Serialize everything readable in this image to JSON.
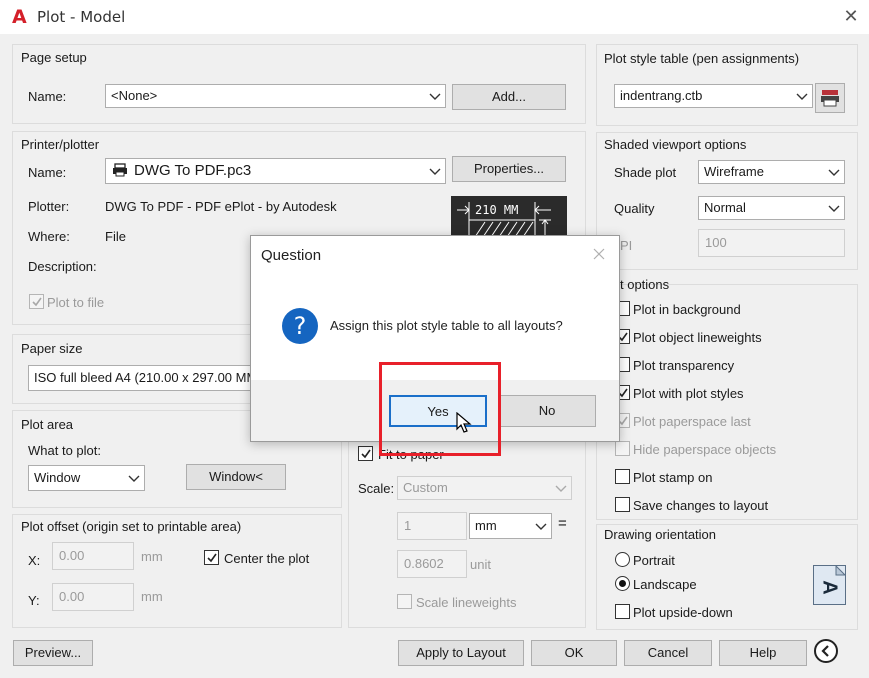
{
  "window": {
    "title": "Plot - Model",
    "close_glyph": "✕",
    "logo_letter": "A"
  },
  "page_setup": {
    "group": "Page setup",
    "name_label": "Name:",
    "name_value": "<None>",
    "add_button": "Add..."
  },
  "printer": {
    "group": "Printer/plotter",
    "name_label": "Name:",
    "name_value": "DWG To PDF.pc3",
    "properties_button": "Properties...",
    "plotter_label": "Plotter:",
    "plotter_value": "DWG To PDF - PDF ePlot - by Autodesk",
    "where_label": "Where:",
    "where_value": "File",
    "description_label": "Description:",
    "plot_to_file": "Plot to file",
    "preview_dim": "210 MM"
  },
  "paper_size": {
    "group": "Paper size",
    "value": "ISO full bleed A4 (210.00 x 297.00 MM"
  },
  "plot_area": {
    "group": "Plot area",
    "what_label": "What to plot:",
    "what_value": "Window",
    "window_button": "Window<"
  },
  "plot_offset": {
    "group": "Plot offset (origin set to printable area)",
    "x_label": "X:",
    "x_value": "0.00",
    "x_unit": "mm",
    "y_label": "Y:",
    "y_value": "0.00",
    "y_unit": "mm",
    "center_label": "Center the plot"
  },
  "plot_scale": {
    "fit_label": "Fit to paper",
    "scale_label": "Scale:",
    "scale_value": "Custom",
    "num_value": "1",
    "unit_value": "mm",
    "equals": "=",
    "den_value": "0.8602",
    "den_unit": "unit",
    "lineweights_label": "Scale lineweights"
  },
  "plot_style_table": {
    "group": "Plot style table (pen assignments)",
    "value": "indentrang.ctb"
  },
  "shaded_viewport": {
    "group": "Shaded viewport options",
    "shade_label": "Shade plot",
    "shade_value": "Wireframe",
    "quality_label": "Quality",
    "quality_value": "Normal",
    "dpi_label": "PI",
    "dpi_value": "100"
  },
  "plot_options": {
    "group": "t options",
    "items": [
      {
        "label": "Plot in background",
        "checked": false,
        "disabled": false
      },
      {
        "label": "Plot object lineweights",
        "checked": true,
        "disabled": false
      },
      {
        "label": "Plot transparency",
        "checked": false,
        "disabled": false
      },
      {
        "label": "Plot with plot styles",
        "checked": true,
        "disabled": false
      },
      {
        "label": "Plot paperspace last",
        "checked": true,
        "disabled": true
      },
      {
        "label": "Hide paperspace objects",
        "checked": false,
        "disabled": true
      },
      {
        "label": "Plot stamp on",
        "checked": false,
        "disabled": false
      },
      {
        "label": "Save changes to layout",
        "checked": false,
        "disabled": false
      }
    ]
  },
  "drawing_orientation": {
    "group": "Drawing orientation",
    "portrait": "Portrait",
    "landscape": "Landscape",
    "upside_down": "Plot upside-down",
    "page_letter": "A"
  },
  "bottom": {
    "preview": "Preview...",
    "apply": "Apply to Layout",
    "ok": "OK",
    "cancel": "Cancel",
    "help": "Help"
  },
  "dialog": {
    "title": "Question",
    "message": "Assign this plot style table to all layouts?",
    "yes": "Yes",
    "no": "No",
    "question_glyph": "?"
  },
  "colors": {
    "accent": "#1a6fc9",
    "highlight": "#e8202a",
    "dialog_icon": "#1565c0"
  }
}
